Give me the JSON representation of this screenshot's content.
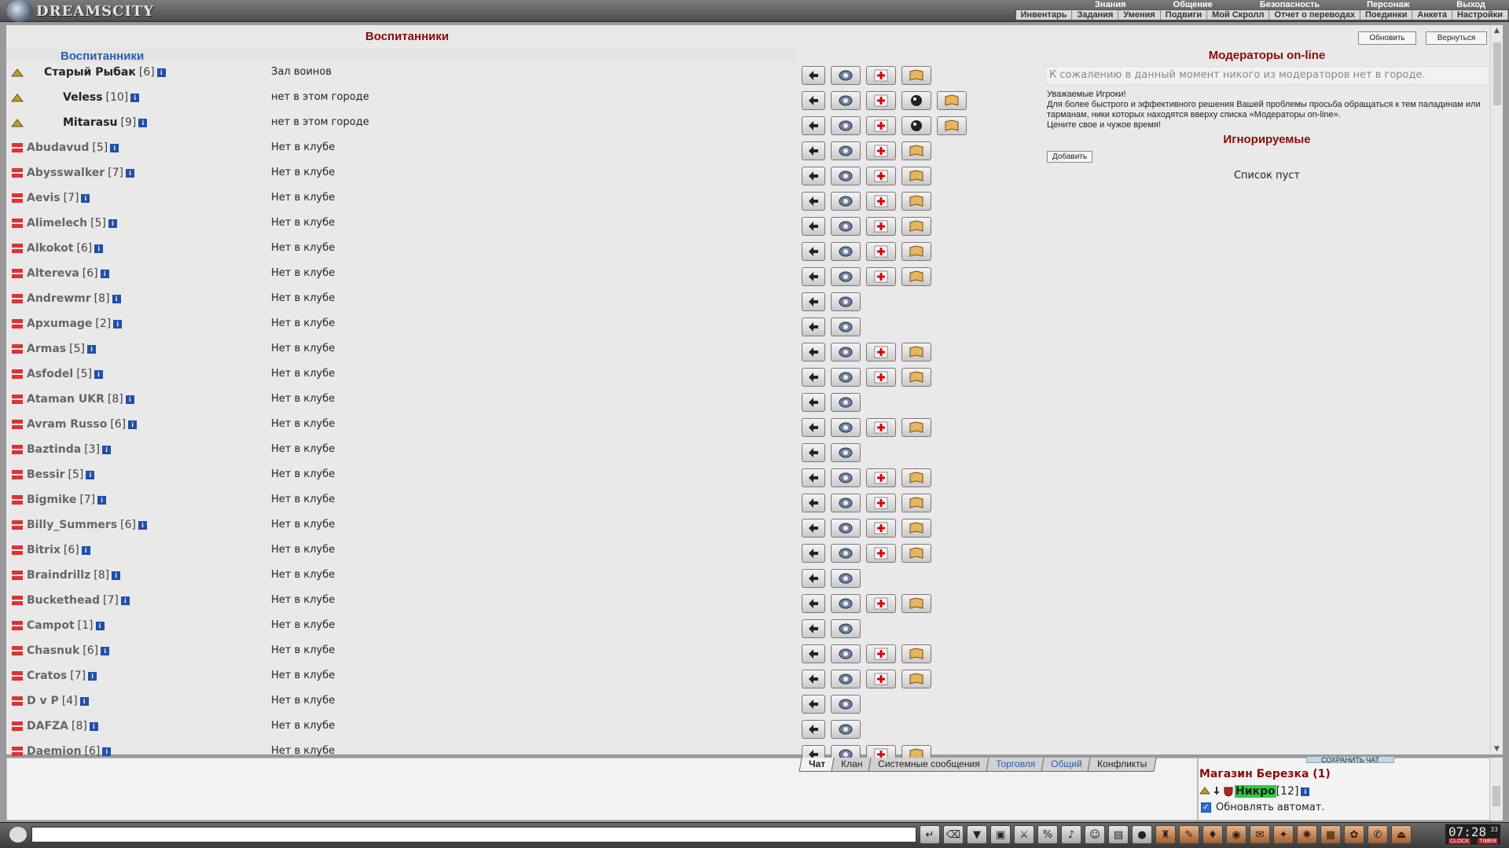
{
  "topbar": {
    "logo": "DREAMSCITY",
    "nav1": [
      "Знания",
      "Общение",
      "Безопасность",
      "Персонаж",
      "Выход"
    ],
    "nav2": [
      "Инвентарь",
      "Задания",
      "Умения",
      "Подвиги",
      "Мой Скролл",
      "Отчет о переводах",
      "Поединки",
      "Анкета",
      "Настройки"
    ]
  },
  "main": {
    "title": "Воспитанники",
    "subhead": "Воспитанники",
    "refresh_label": "Обновить",
    "back_label": "Вернуться",
    "rows": [
      {
        "name": "Старый Рыбак",
        "level": "[6]",
        "location": "Зал воинов",
        "online": true,
        "actions": 4
      },
      {
        "name": "Veless",
        "level": "[10]",
        "location": "нет в этом городе",
        "online": true,
        "actions": 5
      },
      {
        "name": "Mitarasu",
        "level": "[9]",
        "location": "нет в этом городе",
        "online": true,
        "actions": 5
      },
      {
        "name": "Abudavud",
        "level": "[5]",
        "location": "Нет в клубе",
        "online": false,
        "actions": 4
      },
      {
        "name": "Abysswalker",
        "level": "[7]",
        "location": "Нет в клубе",
        "online": false,
        "actions": 4
      },
      {
        "name": "Aevis",
        "level": "[7]",
        "location": "Нет в клубе",
        "online": false,
        "actions": 4
      },
      {
        "name": "Alimelech",
        "level": "[5]",
        "location": "Нет в клубе",
        "online": false,
        "actions": 4
      },
      {
        "name": "Alkokot",
        "level": "[6]",
        "location": "Нет в клубе",
        "online": false,
        "actions": 4
      },
      {
        "name": "Altereva",
        "level": "[6]",
        "location": "Нет в клубе",
        "online": false,
        "actions": 4
      },
      {
        "name": "Andrewmr",
        "level": "[8]",
        "location": "Нет в клубе",
        "online": false,
        "actions": 2
      },
      {
        "name": "Apxumage",
        "level": "[2]",
        "location": "Нет в клубе",
        "online": false,
        "actions": 2
      },
      {
        "name": "Armas",
        "level": "[5]",
        "location": "Нет в клубе",
        "online": false,
        "actions": 4
      },
      {
        "name": "Asfodel",
        "level": "[5]",
        "location": "Нет в клубе",
        "online": false,
        "actions": 4
      },
      {
        "name": "Ataman UKR",
        "level": "[8]",
        "location": "Нет в клубе",
        "online": false,
        "actions": 2
      },
      {
        "name": "Avram Russo",
        "level": "[6]",
        "location": "Нет в клубе",
        "online": false,
        "actions": 4
      },
      {
        "name": "Baztinda",
        "level": "[3]",
        "location": "Нет в клубе",
        "online": false,
        "actions": 2
      },
      {
        "name": "Bessir",
        "level": "[5]",
        "location": "Нет в клубе",
        "online": false,
        "actions": 4
      },
      {
        "name": "Bigmike",
        "level": "[7]",
        "location": "Нет в клубе",
        "online": false,
        "actions": 4
      },
      {
        "name": "Billy_Summers",
        "level": "[6]",
        "location": "Нет в клубе",
        "online": false,
        "actions": 4
      },
      {
        "name": "Bitrix",
        "level": "[6]",
        "location": "Нет в клубе",
        "online": false,
        "actions": 4
      },
      {
        "name": "Braindrillz",
        "level": "[8]",
        "location": "Нет в клубе",
        "online": false,
        "actions": 2
      },
      {
        "name": "Buckethead",
        "level": "[7]",
        "location": "Нет в клубе",
        "online": false,
        "actions": 4
      },
      {
        "name": "Campot",
        "level": "[1]",
        "location": "Нет в клубе",
        "online": false,
        "actions": 2
      },
      {
        "name": "Chasnuk",
        "level": "[6]",
        "location": "Нет в клубе",
        "online": false,
        "actions": 4
      },
      {
        "name": "Cratos",
        "level": "[7]",
        "location": "Нет в клубе",
        "online": false,
        "actions": 4
      },
      {
        "name": "D v P",
        "level": "[4]",
        "location": "Нет в клубе",
        "online": false,
        "actions": 2
      },
      {
        "name": "DAFZA",
        "level": "[8]",
        "location": "Нет в клубе",
        "online": false,
        "actions": 2
      },
      {
        "name": "Daemion",
        "level": "[6]",
        "location": "Нет в клубе",
        "online": false,
        "actions": 4
      }
    ]
  },
  "moderators": {
    "title": "Модераторы on-line",
    "empty": "К сожалению в данный момент никого из модераторов нет в городе.",
    "notice1": "Уважаемые Игроки!",
    "notice2": "Для более быстрого и эффективного решения Вашей проблемы просьба обращаться к тем паладинам или тарманам, ники которых находятся вверху списка «Модераторы on-line».",
    "notice3": "Цените свое и чужое время!"
  },
  "ignored": {
    "title": "Игнорируемые",
    "add_label": "Добавить",
    "empty": "Список пуст"
  },
  "chat": {
    "tabs": [
      "Чат",
      "Клан",
      "Системные сообщения",
      "Торговля",
      "Общий",
      "Конфликты"
    ],
    "save_label": "СОХРАНИТЬ ЧАТ"
  },
  "online_panel": {
    "location": "Магазин Березка (1)",
    "user_name": "Никро",
    "user_level": "[12]",
    "auto_refresh": "Обновлять автомат."
  },
  "clock": {
    "time": "07:28",
    "seconds": "33",
    "label_left": "CLOCK",
    "label_right": "TIMER"
  },
  "colors": {
    "title_red": "#8b0a0a",
    "link_blue": "#2a5db6",
    "highlight_green": "#2ecc40"
  }
}
